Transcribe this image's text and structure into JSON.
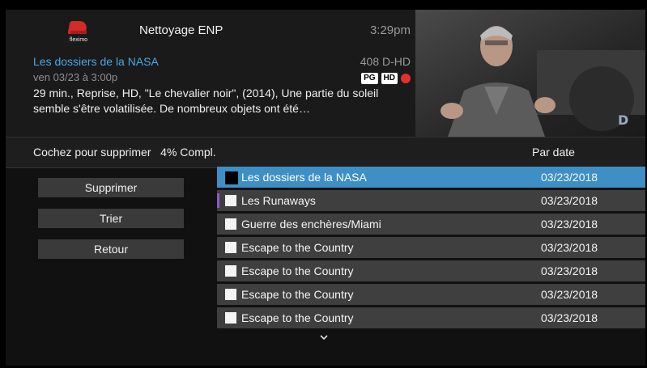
{
  "header": {
    "logo_text": "fleximo",
    "channel_title": "Nettoyage ENP",
    "clock": "3:29pm"
  },
  "program": {
    "title": "Les dossiers de la NASA",
    "channel_number": "408 D-HD",
    "airtime": "ven 03/23 à 3:00p",
    "badges": [
      "PG",
      "HD"
    ],
    "description": "29 min., Reprise, HD, \"Le chevalier noir\", (2014), Une partie du soleil semble s'être volatilisée. De nombreux objets ont été…"
  },
  "subheader": {
    "left_label": "Cochez pour supprimer   4% Compl.",
    "sort_label": "Par date"
  },
  "actions": [
    {
      "label": "Supprimer"
    },
    {
      "label": "Trier"
    },
    {
      "label": "Retour"
    }
  ],
  "recordings": [
    {
      "title": "Les dossiers de la NASA",
      "date": "03/23/2018",
      "selected": true
    },
    {
      "title": "Les Runaways",
      "date": "03/23/2018",
      "selected": false
    },
    {
      "title": "Guerre des enchères/Miami",
      "date": "03/23/2018",
      "selected": false
    },
    {
      "title": "Escape to the Country",
      "date": "03/23/2018",
      "selected": false
    },
    {
      "title": "Escape to the Country",
      "date": "03/23/2018",
      "selected": false
    },
    {
      "title": "Escape to the Country",
      "date": "03/23/2018",
      "selected": false
    },
    {
      "title": "Escape to the Country",
      "date": "03/23/2018",
      "selected": false
    }
  ],
  "colors": {
    "accent": "#3d8fc5",
    "title_blue": "#4aa6e6",
    "record_red": "#e53030"
  },
  "icons": {
    "more_below": "chevron-down-icon",
    "record": "record-dot-icon"
  }
}
